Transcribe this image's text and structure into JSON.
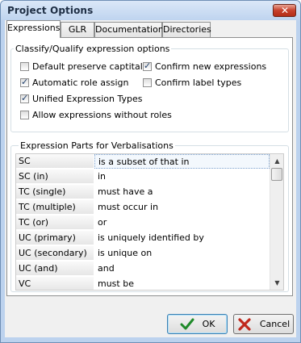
{
  "window": {
    "title": "Project Options",
    "close_glyph": "✕"
  },
  "tabs": [
    {
      "label": "Expressions",
      "active": true
    },
    {
      "label": "GLR",
      "active": false
    },
    {
      "label": "Documentation",
      "active": false
    },
    {
      "label": "Directories",
      "active": false
    }
  ],
  "classify_group": {
    "title": "Classify/Qualify expression options",
    "options": [
      {
        "label": "Default preserve captital",
        "checked": false
      },
      {
        "label": "Confirm new expressions",
        "checked": true
      },
      {
        "label": "Automatic role assign",
        "checked": true
      },
      {
        "label": "Confirm label types",
        "checked": false
      },
      {
        "label": "Unified Expression Types",
        "checked": true
      },
      {
        "label": "Allow expressions without roles",
        "checked": false
      }
    ]
  },
  "parts_group": {
    "title": "Expression Parts for Verbalisations",
    "rows": [
      {
        "part": "SC",
        "text": "is a subset of that in",
        "selected": true
      },
      {
        "part": "SC (in)",
        "text": "in",
        "selected": false
      },
      {
        "part": "TC (single)",
        "text": "must have a",
        "selected": false
      },
      {
        "part": "TC (multiple)",
        "text": "must occur in",
        "selected": false
      },
      {
        "part": "TC (or)",
        "text": "or",
        "selected": false
      },
      {
        "part": "UC (primary)",
        "text": "is uniquely identified by",
        "selected": false
      },
      {
        "part": "UC (secondary)",
        "text": "is unique on",
        "selected": false
      },
      {
        "part": "UC (and)",
        "text": "and",
        "selected": false
      },
      {
        "part": "VC",
        "text": "must be",
        "selected": false
      }
    ],
    "scroll_up": "▲",
    "scroll_down": "▼"
  },
  "buttons": {
    "ok": "OK",
    "cancel": "Cancel"
  },
  "colors": {
    "ok_icon": "#1f8a2a",
    "cancel_icon": "#c0281c"
  }
}
